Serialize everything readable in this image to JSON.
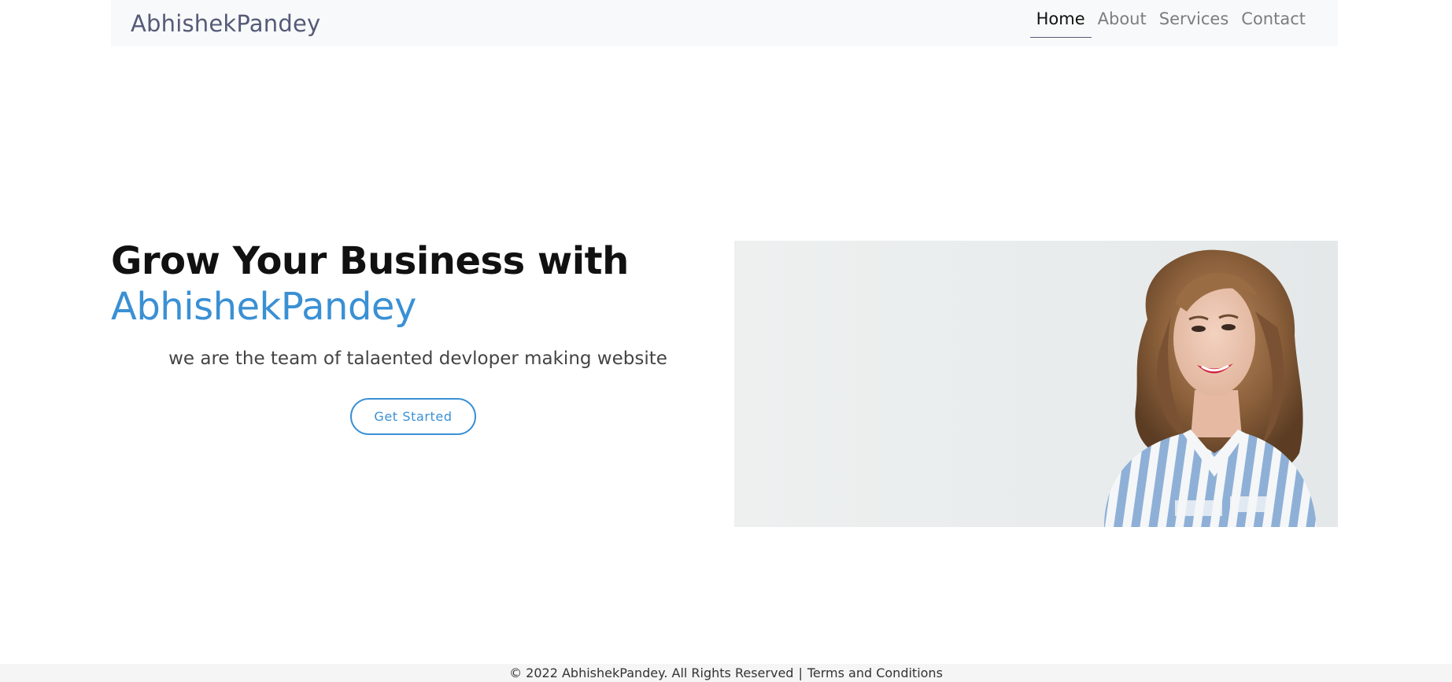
{
  "navbar": {
    "brand": "AbhishekPandey",
    "links": [
      {
        "label": "Home",
        "active": true
      },
      {
        "label": "About",
        "active": false
      },
      {
        "label": "Services",
        "active": false
      },
      {
        "label": "Contact",
        "active": false
      }
    ]
  },
  "hero": {
    "title_line1": "Grow Your Business with",
    "title_brand": "AbhishekPandey",
    "subtitle": "we are the team of talaented devloper making website",
    "cta_label": "Get Started",
    "image_icon": "smiling-woman-portrait"
  },
  "footer": {
    "copyright": "© 2022 AbhishekPandey. All Rights Reserved",
    "separator": "|",
    "terms_link": "Terms and Conditions"
  },
  "colors": {
    "accent": "#3a90d4",
    "brand_text": "#555a78",
    "navbar_bg": "#f8f9fa",
    "footer_bg": "#f5f5f5"
  }
}
